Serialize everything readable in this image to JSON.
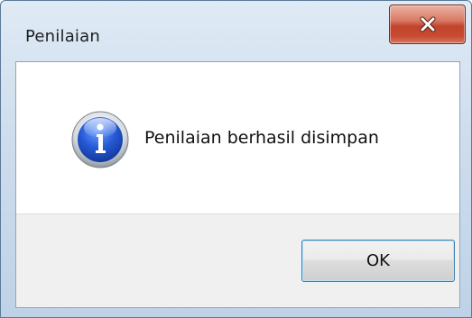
{
  "window": {
    "title": "Penilaian",
    "close_icon": "close-icon"
  },
  "dialog": {
    "icon": "info-icon",
    "message": "Penilaian berhasil disimpan",
    "ok_label": "OK"
  },
  "colors": {
    "close_button": "#c7472f",
    "ok_border": "#3c7fb1",
    "button_area": "#f0f0f0",
    "info_icon": "#1f4fc2"
  }
}
